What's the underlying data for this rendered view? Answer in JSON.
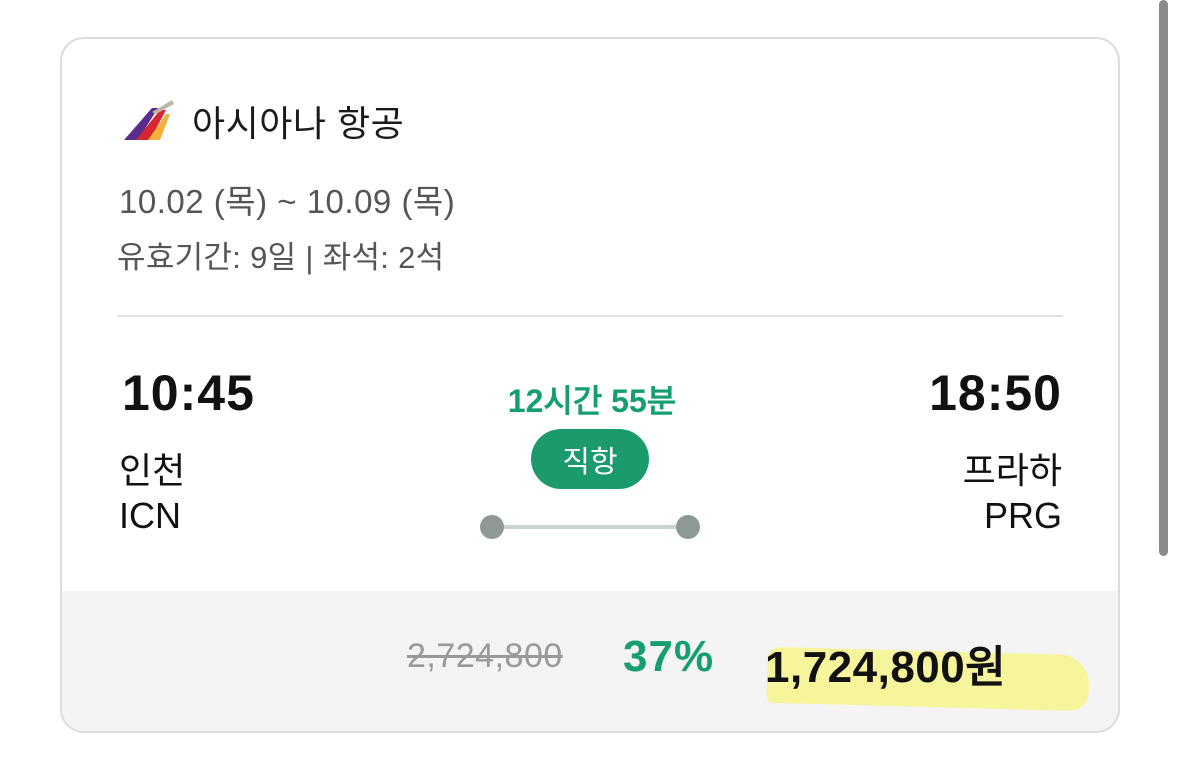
{
  "airline": {
    "name": "아시아나 항공",
    "logo_icon": "asiana-airlines-logo-icon",
    "logo_colors": [
      "#f3b13b",
      "#d8262f",
      "#5b2c8c"
    ]
  },
  "trip": {
    "dates": "10.02 (목) ~ 10.09 (목)",
    "validity": "유효기간: 9일 | 좌석: 2석"
  },
  "departure": {
    "time": "10:45",
    "city": "인천",
    "code": "ICN"
  },
  "arrival": {
    "time": "18:50",
    "city": "프라하",
    "code": "PRG"
  },
  "flight": {
    "duration": "12시간 55분",
    "type": "직항"
  },
  "price": {
    "original": "2,724,800",
    "discount": "37%",
    "final": "1,724,800원"
  },
  "colors": {
    "accent_green": "#159e6f",
    "badge_green": "#1b9a6c",
    "highlight_yellow": "#f6f48c"
  }
}
